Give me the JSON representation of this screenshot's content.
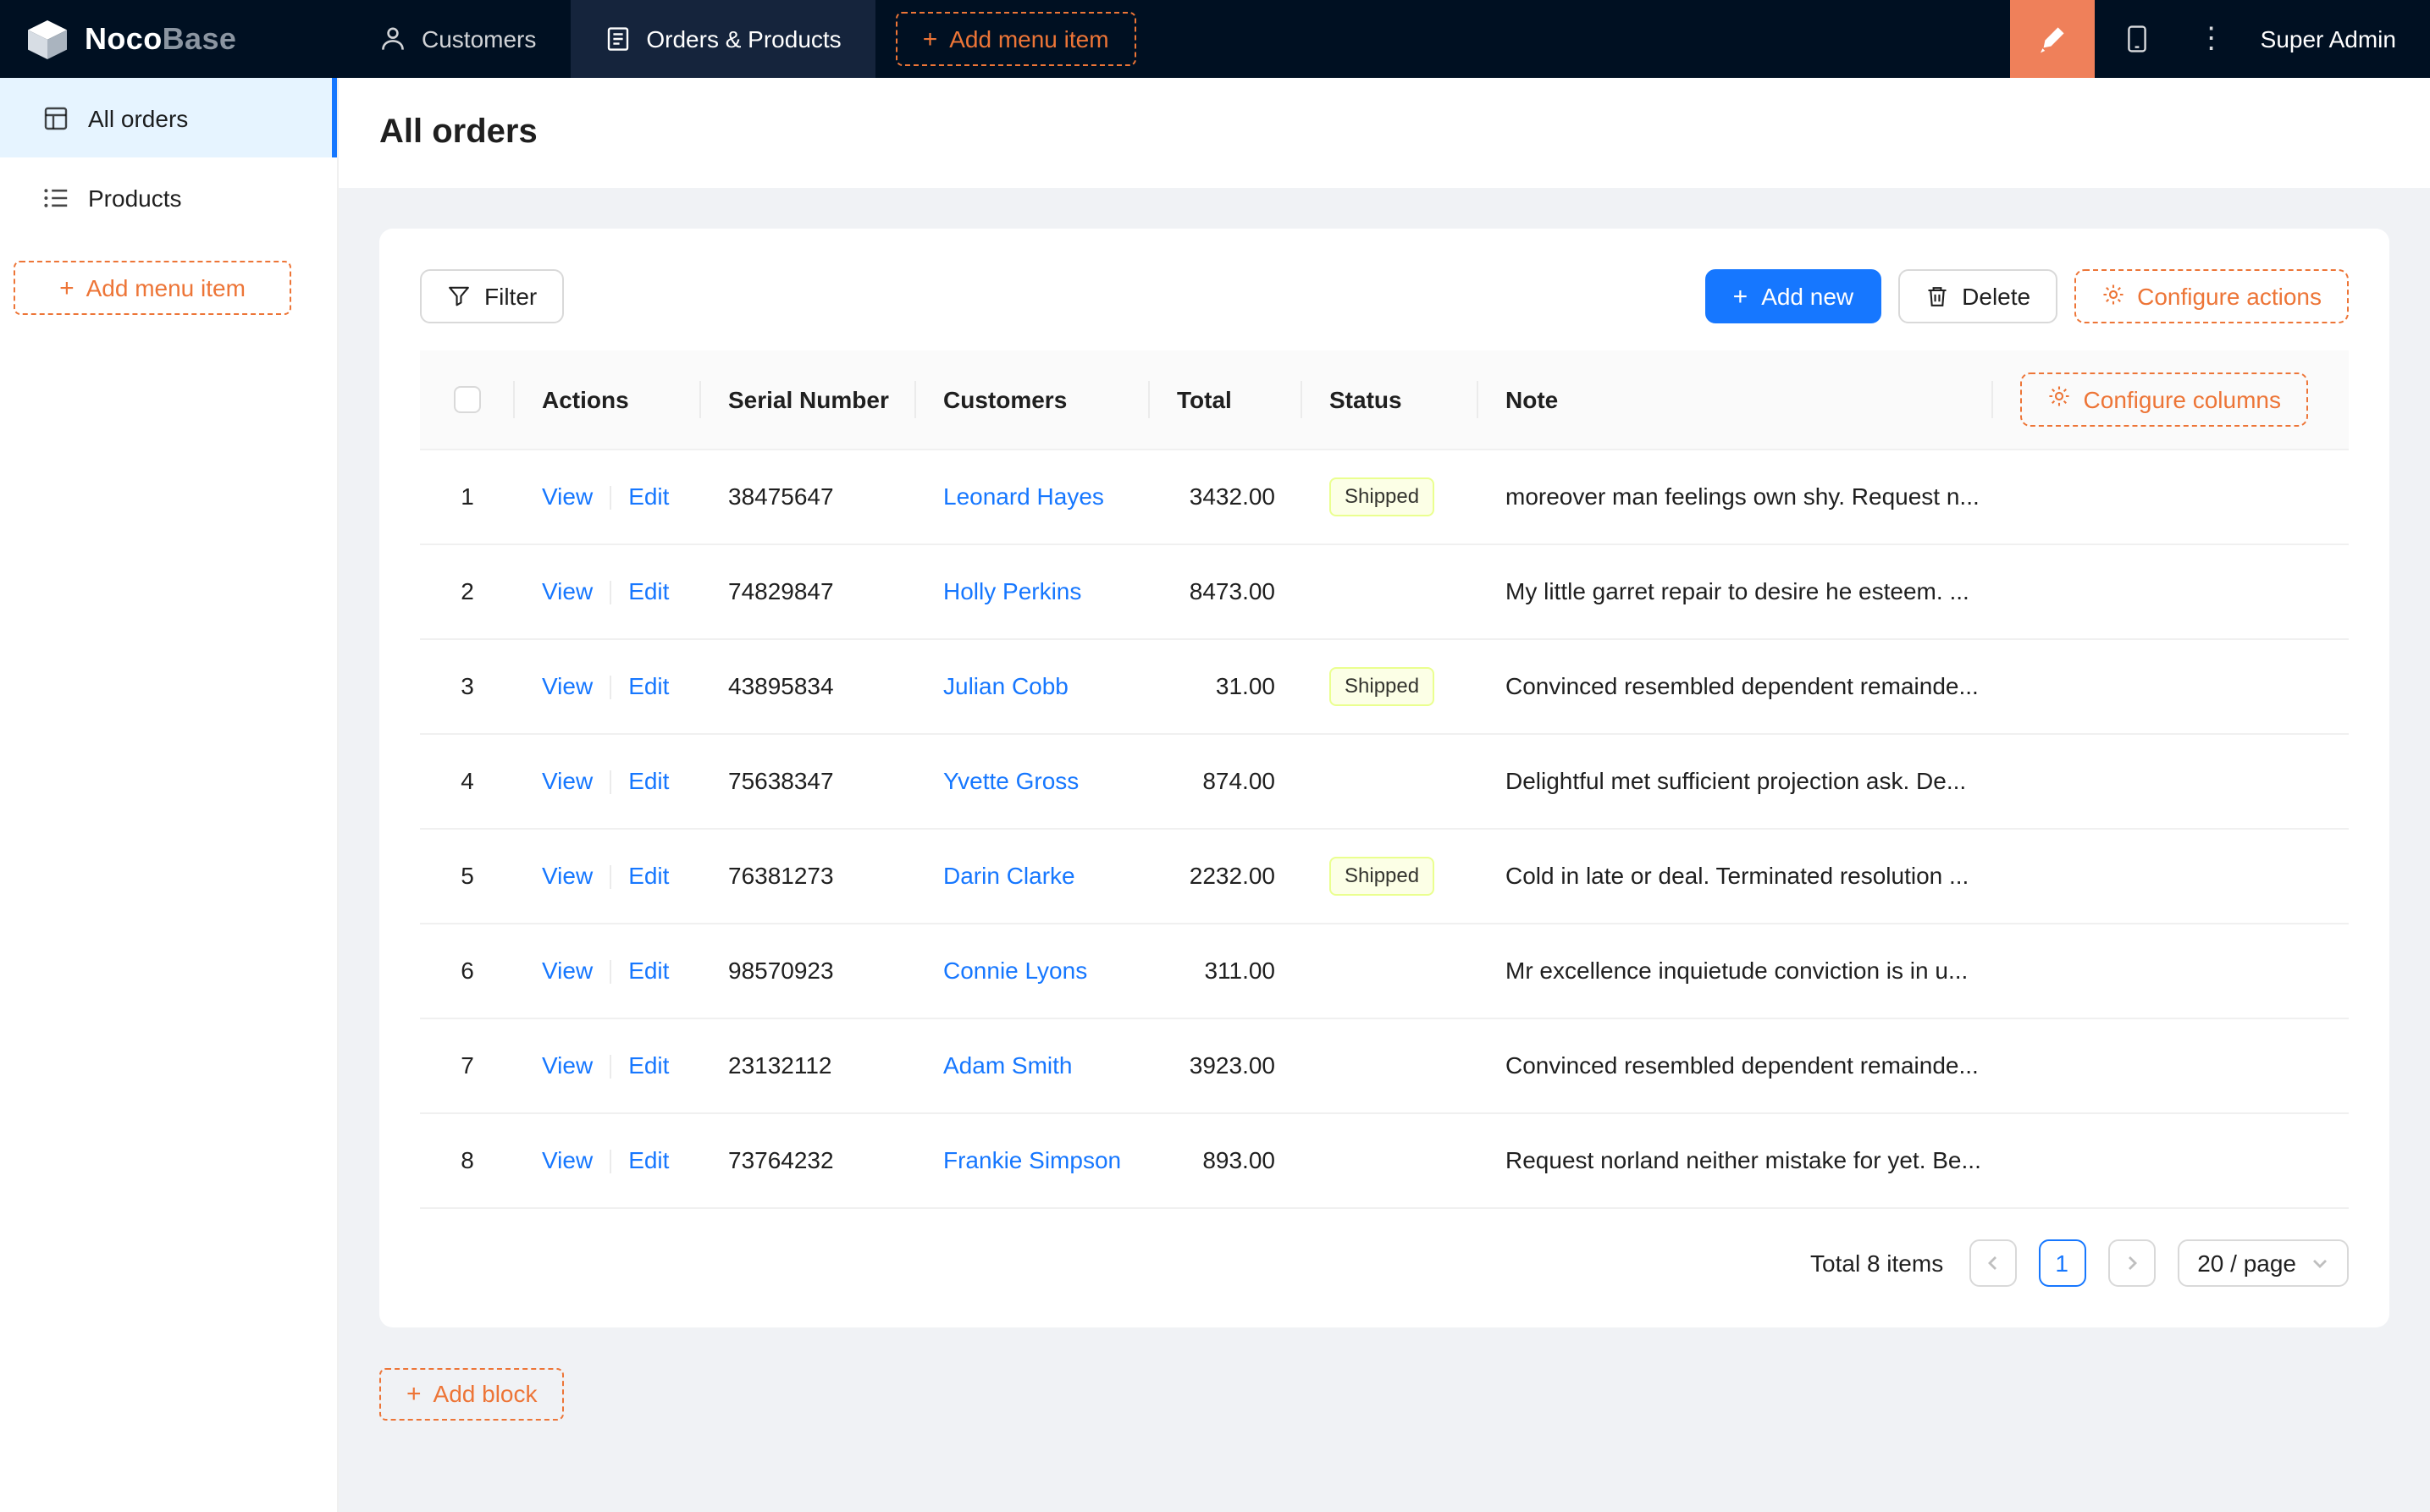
{
  "ui": {
    "plus": "+",
    "kebab": "⋮"
  },
  "colors": {
    "primary": "#1677ff",
    "designer_block_orange": "#ef805a",
    "dashed_orange": "#ed7537",
    "header_bg": "#001022",
    "sidebar_active_bg": "#e6f4ff",
    "badge_bg": "#fcffe6",
    "badge_border": "#eaff8f"
  },
  "header": {
    "logo_noco": "Noco",
    "logo_base": "Base",
    "menu": [
      {
        "label": "Customers"
      },
      {
        "label": "Orders & Products"
      }
    ],
    "add_menu_item": "Add menu item",
    "user": "Super Admin"
  },
  "sidebar": {
    "items": [
      {
        "label": "All orders"
      },
      {
        "label": "Products"
      }
    ],
    "add_menu_item": "Add menu item"
  },
  "page": {
    "title": "All orders",
    "add_block": "Add block"
  },
  "toolbar": {
    "filter": "Filter",
    "add_new": "Add new",
    "delete": "Delete",
    "configure_actions": "Configure actions"
  },
  "table": {
    "configure_columns": "Configure columns",
    "columns": {
      "actions": "Actions",
      "serial": "Serial Number",
      "customers": "Customers",
      "total": "Total",
      "status": "Status",
      "note": "Note"
    },
    "row_actions": {
      "view": "View",
      "edit": "Edit"
    },
    "rows": [
      {
        "index": "1",
        "serial": "38475647",
        "customer": "Leonard Hayes",
        "total": "3432.00",
        "status": "Shipped",
        "note": "moreover man feelings own shy. Request n..."
      },
      {
        "index": "2",
        "serial": "74829847",
        "customer": "Holly Perkins",
        "total": "8473.00",
        "status": "",
        "note": "My little garret repair to desire he esteem. ..."
      },
      {
        "index": "3",
        "serial": "43895834",
        "customer": "Julian Cobb",
        "total": "31.00",
        "status": "Shipped",
        "note": "Convinced resembled dependent remainde..."
      },
      {
        "index": "4",
        "serial": "75638347",
        "customer": "Yvette Gross",
        "total": "874.00",
        "status": "",
        "note": "Delightful met sufficient projection ask. De..."
      },
      {
        "index": "5",
        "serial": "76381273",
        "customer": "Darin Clarke",
        "total": "2232.00",
        "status": "Shipped",
        "note": "Cold in late or deal. Terminated resolution ..."
      },
      {
        "index": "6",
        "serial": "98570923",
        "customer": "Connie Lyons",
        "total": "311.00",
        "status": "",
        "note": "Mr excellence inquietude conviction is in u..."
      },
      {
        "index": "7",
        "serial": "23132112",
        "customer": "Adam Smith",
        "total": "3923.00",
        "status": "",
        "note": "Convinced resembled dependent remainde..."
      },
      {
        "index": "8",
        "serial": "73764232",
        "customer": "Frankie Simpson",
        "total": "893.00",
        "status": "",
        "note": "Request norland neither mistake for yet. Be..."
      }
    ]
  },
  "pagination": {
    "total": "Total 8 items",
    "current": "1",
    "page_size": "20 / page"
  }
}
